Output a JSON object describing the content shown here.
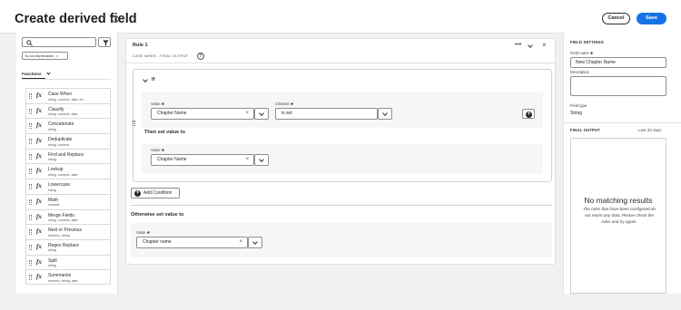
{
  "header": {
    "title": "Create derived field",
    "help_glyph": "?",
    "cancel_label": "Cancel",
    "save_label": "Save"
  },
  "sidebar": {
    "search": {
      "value": "",
      "placeholder": ""
    },
    "filter_tag": "Is not deprecated",
    "tag_close": "×",
    "functions_tab": "Functions",
    "items": [
      {
        "name": "Case When",
        "types": "string, numeric, date, en..."
      },
      {
        "name": "Classify",
        "types": "string, numeric, date"
      },
      {
        "name": "Concatenate",
        "types": "string"
      },
      {
        "name": "Deduplicate",
        "types": "string, numeric"
      },
      {
        "name": "Find and Replace",
        "types": "string"
      },
      {
        "name": "Lookup",
        "types": "string, numeric, date"
      },
      {
        "name": "Lowercase",
        "types": "string"
      },
      {
        "name": "Math",
        "types": "numeric"
      },
      {
        "name": "Merge Fields",
        "types": "string, numeric, date"
      },
      {
        "name": "Next or Previous",
        "types": "numeric, string"
      },
      {
        "name": "Regex Replace",
        "types": "string"
      },
      {
        "name": "Split",
        "types": "string"
      },
      {
        "name": "Summarize",
        "types": "numeric, string, date"
      }
    ],
    "fx_glyph": "fx"
  },
  "rule": {
    "title": "Rule 1",
    "subtitle": "CASE WHEN - FINAL OUTPUT",
    "menu_glyph": "•••",
    "close_glyph": "×",
    "if_label": "If",
    "value_label": "Value",
    "criterion_label": "Criterion",
    "required_mark": "✱",
    "condition_value": "Chapter Name",
    "condition_criterion": "is set",
    "clear_glyph": "×",
    "then_label": "Then set value to",
    "then_value": "Chapter Name",
    "add_condition_label": "Add Condition",
    "otherwise_label": "Otherwise set value to",
    "otherwise_value": "Chapter name"
  },
  "field_settings": {
    "title": "FIELD SETTINGS",
    "field_name_label": "Field name",
    "field_name_value": "New Chapter Name",
    "description_label": "Description",
    "description_value": "",
    "field_type_label": "Field type",
    "field_type_value": "String"
  },
  "final_output": {
    "title": "FINAL OUTPUT",
    "range": "Last 30 days",
    "empty_title": "No matching results",
    "empty_text": "The rules that have been configured do not return any data. Please check the rules and try again."
  }
}
